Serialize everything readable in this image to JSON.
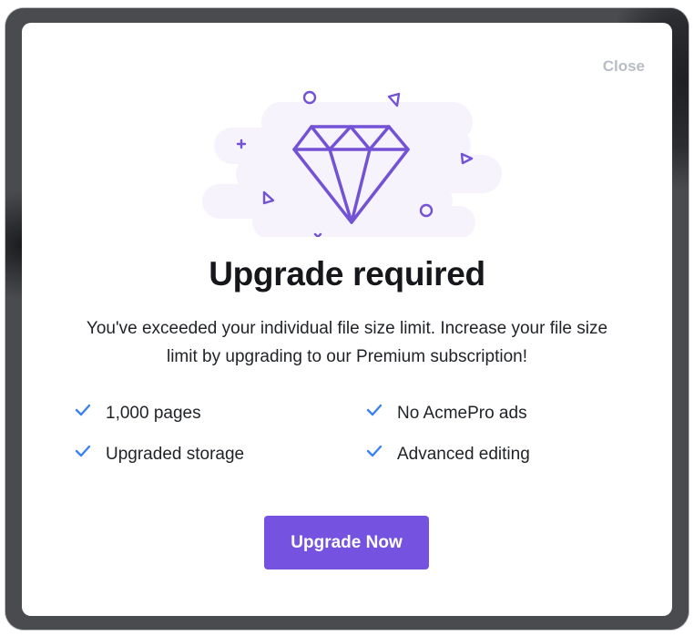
{
  "modal": {
    "close_label": "Close",
    "title": "Upgrade required",
    "description": "You've exceeded your individual file size limit. Increase your file size limit by upgrading to our Premium subscription!",
    "features": [
      "1,000 pages",
      "No AcmePro ads",
      "Upgraded storage",
      "Advanced editing"
    ],
    "cta_label": "Upgrade Now"
  },
  "icons": {
    "illustration": "diamond-icon",
    "feature_check": "check-icon"
  },
  "colors": {
    "accent": "#7652e0",
    "check": "#3b82f6",
    "illustration_line": "#7452d6",
    "illustration_bg": "#f6f3fd",
    "close": "#b7bcc6",
    "title": "#15171a"
  }
}
